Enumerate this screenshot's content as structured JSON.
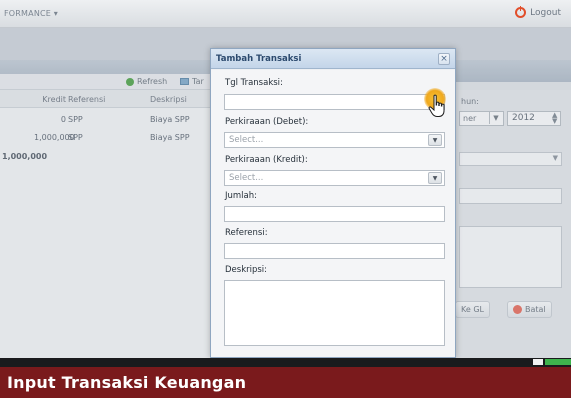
{
  "header": {
    "menu_title": "FORMANCE ▾",
    "logout_label": "Logout",
    "logout_icon": "power-icon"
  },
  "toolbar": {
    "refresh_label": "Refresh",
    "add_label": "Tar"
  },
  "grid": {
    "columns": [
      "Kredit",
      "Referensi",
      "Deskripsi"
    ],
    "rows": [
      {
        "kredit": "0",
        "referensi": "SPP",
        "deskripsi": "Biaya SPP"
      },
      {
        "kredit": "1,000,000",
        "referensi": "SPP",
        "deskripsi": "Biaya SPP"
      }
    ],
    "total": "1,000,000"
  },
  "right_panel": {
    "tahun_label": "hun:",
    "month_value": "ner",
    "year_value": "2012",
    "ke_gl_label": "Ke GL",
    "batal_label": "Batal"
  },
  "dialog": {
    "title": "Tambah Transaksi",
    "close_glyph": "×",
    "fields": {
      "tgl_label": "Tgl Transaksi:",
      "tgl_value": "",
      "debet_label": "Perkiraaan (Debet):",
      "debet_placeholder": "Select...",
      "kredit_label": "Perkiraaan (Kredit):",
      "kredit_placeholder": "Select...",
      "jumlah_label": "Jumlah:",
      "jumlah_value": "",
      "referensi_label": "Referensi:",
      "referensi_value": "",
      "deskripsi_label": "Deskripsi:",
      "deskripsi_value": ""
    }
  },
  "caption": {
    "text": "Input Transaksi Keuangan"
  },
  "colors": {
    "caption_bg": "#7a1a1c",
    "dialog_header": "#c3d5e9",
    "logout_icon": "#e14e2a",
    "cursor_highlight": "#f0a81c"
  }
}
